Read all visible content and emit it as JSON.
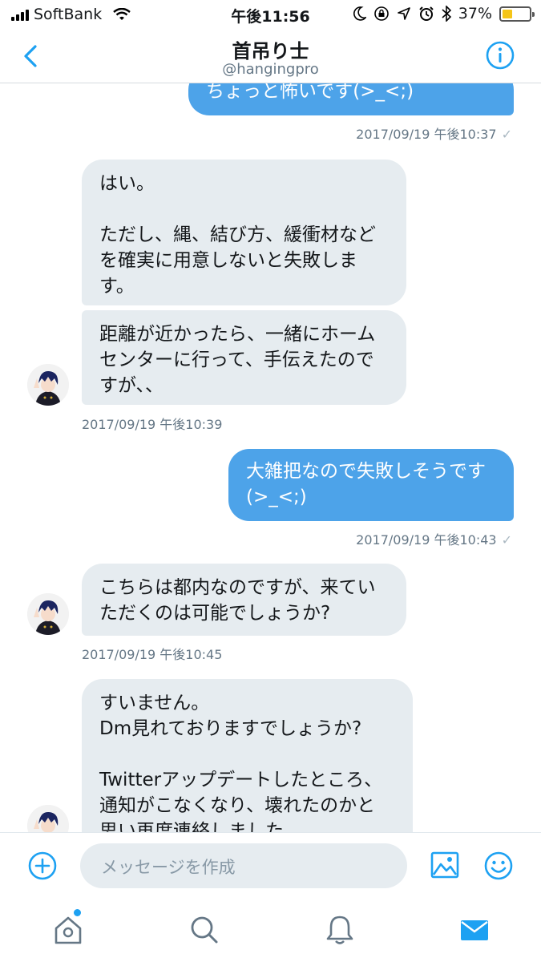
{
  "status_bar": {
    "carrier": "SoftBank",
    "time": "午後11:56",
    "battery_percent": "37%",
    "battery_level": 0.37,
    "icons": [
      "signal-icon",
      "wifi-icon",
      "moon-icon",
      "orientation-lock-icon",
      "location-icon",
      "alarm-icon",
      "bluetooth-icon",
      "battery-icon"
    ]
  },
  "header": {
    "name": "首吊り士",
    "handle": "@hangingpro",
    "back_icon": "chevron-left-icon",
    "info_icon": "info-icon"
  },
  "conversation": {
    "m1": {
      "text": "ちょっと怖いです(>_<;)",
      "sender": "me"
    },
    "t1": "2017/09/19 午後10:37",
    "m2": {
      "text": "はい。\n\nただし、縄、結び方、緩衝材など\nを確実に用意しないと失敗しま\nす。",
      "sender": "them"
    },
    "m3": {
      "text": "距離が近かったら、一緒にホーム\nセンターに行って、手伝えたので\nすが、、",
      "sender": "them"
    },
    "t2": "2017/09/19 午後10:39",
    "m4": {
      "text": "大雑把なので失敗しそうです\n(>_<;)",
      "sender": "me"
    },
    "t3": "2017/09/19 午後10:43",
    "m5": {
      "text": "こちらは都内なのですが、来てい\nただくのは可能でしょうか?",
      "sender": "them"
    },
    "t4": "2017/09/19 午後10:45",
    "m6": {
      "text": "すいません。\nDm見れておりますでしょうか?\n\nTwitterアップデートしたところ、\n通知がこなくなり、壊れたのかと\n思い再度連絡しました。",
      "sender": "them"
    },
    "read_check": "✓"
  },
  "composer": {
    "placeholder": "メッセージを作成",
    "add_icon": "plus-circle-icon",
    "image_icon": "image-icon",
    "emoji_icon": "emoji-icon"
  },
  "tab_bar": {
    "tabs": [
      "home-icon",
      "search-icon",
      "notifications-icon",
      "messages-icon"
    ],
    "active": "messages-icon"
  },
  "colors": {
    "accent": "#1da1f2",
    "outgoing_bubble": "#4da3e9",
    "incoming_bubble": "#e6ecf0",
    "secondary_text": "#657786"
  }
}
